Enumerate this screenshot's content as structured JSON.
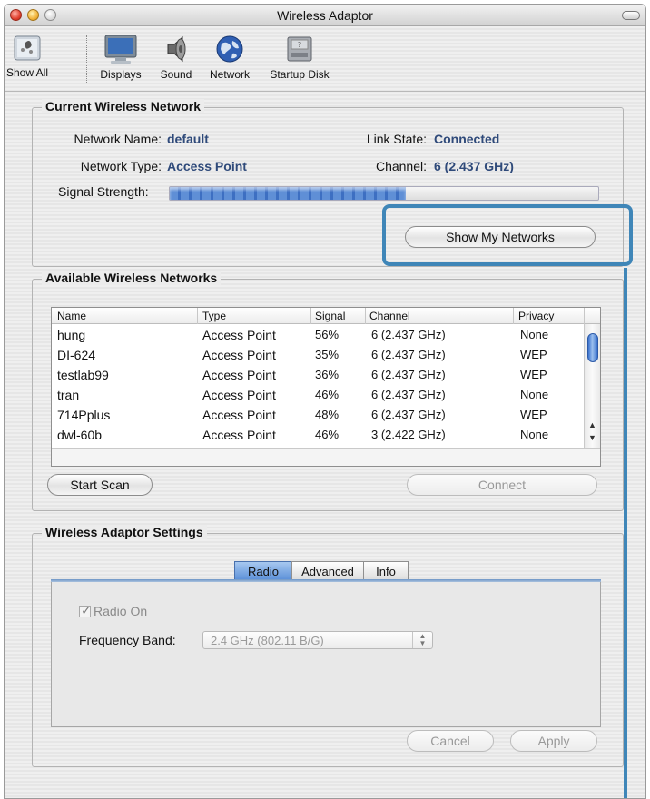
{
  "window": {
    "title": "Wireless Adaptor"
  },
  "toolbar": {
    "items": [
      {
        "label": "Show All",
        "icon": "show-all-icon"
      },
      {
        "label": "Displays",
        "icon": "display-icon"
      },
      {
        "label": "Sound",
        "icon": "speaker-icon"
      },
      {
        "label": "Network",
        "icon": "globe-icon"
      },
      {
        "label": "Startup Disk",
        "icon": "disk-icon"
      }
    ]
  },
  "current": {
    "title": "Current Wireless Network",
    "network_name_label": "Network Name:",
    "network_name": "default",
    "link_state_label": "Link State:",
    "link_state": "Connected",
    "network_type_label": "Network Type:",
    "network_type": "Access Point",
    "channel_label": "Channel:",
    "channel": "6 (2.437 GHz)",
    "signal_label": "Signal Strength:",
    "signal_fraction": 0.55,
    "show_networks_button": "Show My Networks"
  },
  "available": {
    "title": "Available Wireless Networks",
    "columns": [
      "Name",
      "Type",
      "Signal",
      "Channel",
      "Privacy"
    ],
    "rows": [
      [
        "hung",
        "Access Point",
        "56%",
        "6 (2.437 GHz)",
        "None"
      ],
      [
        "DI-624",
        "Access Point",
        "35%",
        "6 (2.437 GHz)",
        "WEP"
      ],
      [
        "testlab99",
        "Access Point",
        "36%",
        "6 (2.437 GHz)",
        "WEP"
      ],
      [
        "tran",
        "Access Point",
        "46%",
        "6 (2.437 GHz)",
        "None"
      ],
      [
        "714Pplus",
        "Access Point",
        "48%",
        "6 (2.437 GHz)",
        "WEP"
      ],
      [
        "dwl-60b",
        "Access Point",
        "46%",
        "3 (2.422 GHz)",
        "None"
      ]
    ],
    "start_scan": "Start Scan",
    "connect": "Connect"
  },
  "settings": {
    "title": "Wireless Adaptor Settings",
    "tabs": [
      "Radio",
      "Advanced",
      "Info"
    ],
    "active_tab": "Radio",
    "radio_on_label": "Radio On",
    "radio_on_checked": true,
    "frequency_label": "Frequency Band:",
    "frequency_value": "2.4 GHz (802.11 B/G)",
    "cancel": "Cancel",
    "apply": "Apply"
  },
  "colors": {
    "highlight": "#3f86b8",
    "value_text": "#2f4a7a",
    "signal_fill": "#5f8fd6"
  }
}
